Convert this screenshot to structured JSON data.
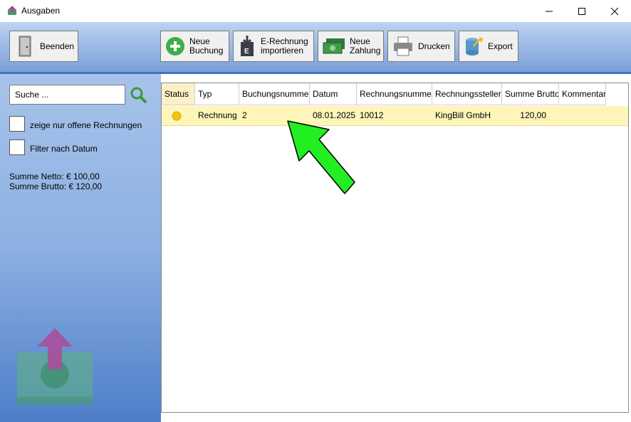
{
  "window": {
    "title": "Ausgaben"
  },
  "toolbar": {
    "buttons": [
      {
        "id": "beenden",
        "label": "Beenden"
      },
      {
        "id": "neue-buchung",
        "label_lines": [
          "Neue",
          "Buchung"
        ]
      },
      {
        "id": "erechnung",
        "label_lines": [
          "E-Rechnung",
          "importieren"
        ]
      },
      {
        "id": "neue-zahlung",
        "label_lines": [
          "Neue",
          "Zahlung"
        ]
      },
      {
        "id": "drucken",
        "label": "Drucken"
      },
      {
        "id": "export",
        "label": "Export"
      }
    ]
  },
  "sidebar": {
    "search_placeholder": "Suche ...",
    "filter_open": {
      "label": "zeige nur offene Rechnungen",
      "checked": false
    },
    "filter_date": {
      "label": "Filter nach Datum",
      "checked": false
    },
    "sum_netto": "Summe Netto: € 100,00",
    "sum_brutto": "Summe Brutto: € 120,00"
  },
  "table": {
    "columns": [
      "Status",
      "Typ",
      "Buchungsnummer",
      "Datum",
      "Rechnungsnummer",
      "Rechnungssteller",
      "Summe Brutto",
      "Kommentar"
    ],
    "rows": [
      {
        "status": "yellow-dot-icon",
        "typ": "Rechnung",
        "buchungsnummer": "2",
        "datum": "08.01.2025",
        "rechnungsnummer": "10012",
        "rechnungssteller": "KingBill GmbH",
        "summe_brutto": "120,00",
        "kommentar": ""
      }
    ]
  },
  "colors": {
    "accent": "#3f74bd",
    "row_highlight": "#fdf5b9",
    "annotation_arrow": "#22ee22"
  }
}
